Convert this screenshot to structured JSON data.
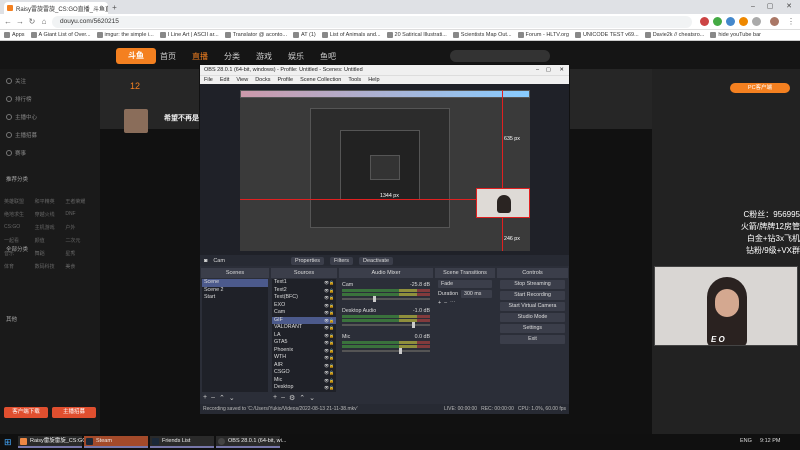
{
  "browser": {
    "tab_title": "Raisy雷旋雷旋_CS:GO直播_斗鱼直播",
    "url": "douyu.com/5620215",
    "bookmarks": [
      "Apps",
      "A Giant List of Over...",
      "imgur: the simple i...",
      "I Line Art | ASCII ar...",
      "Translator @ aconto...",
      "AT (1)",
      "List of Animals and...",
      "20 Satirical Illustrati...",
      "Scientists Map Out...",
      "Forum - HLTV.org",
      "UNICODE TEST v69...",
      "Davie2k // cheatsro...",
      "hide youTube bar"
    ]
  },
  "site": {
    "logo": "斗鱼",
    "nav": [
      "首页",
      "直播",
      "分类",
      "游戏",
      "娱乐",
      "鱼吧"
    ],
    "active_nav": 1,
    "sidebar_top": [
      "关注",
      "排行榜",
      "主播中心",
      "主播招募",
      "赛事"
    ],
    "sidebar_sections": [
      "推荐分类",
      "全部分类",
      "其他"
    ],
    "sidebar_grid": [
      "英雄联盟",
      "和平精英",
      "王者荣耀",
      "绝地求生",
      "穿越火线",
      "DNF",
      "CS:GO",
      "主机游戏",
      "户外",
      "一起看",
      "颜值",
      "二次元",
      "音乐",
      "舞蹈",
      "星秀",
      "体育",
      "数码科技",
      "美食"
    ],
    "sidebar_btn_left": "客户端下载",
    "sidebar_btn_right": "主播招募",
    "follower_count": "12",
    "stream_title_snippet": "希望不再是",
    "button_right": "PC客户端",
    "chat_overlay": [
      "C粉丝：956995",
      "火箭/牌牌12房管",
      "白金+钻3x飞机",
      "钻粉/9级+VX群"
    ],
    "brand_color": "#f48020"
  },
  "obs": {
    "window_title": "OBS 28.0.1 (64-bit, windows) - Profile: Untitled - Scenes: Untitled",
    "menu": [
      "File",
      "Edit",
      "View",
      "Docks",
      "Profile",
      "Scene Collection",
      "Tools",
      "Help"
    ],
    "source_toolbar": {
      "current": "Cam",
      "properties": "Properties",
      "filters": "Filters",
      "deactivate": "Deactivate"
    },
    "scenes": {
      "title": "Scenes",
      "items": [
        "Scene",
        "Scene 2",
        "Start"
      ],
      "selected": 0
    },
    "sources": {
      "title": "Sources",
      "items": [
        "Text1",
        "Text2",
        "Text(BFC)",
        "EXO",
        "Cam",
        "GIF",
        "VALORANT",
        "LA",
        "GTA5",
        "Phoenix",
        "WTH",
        "AIR",
        "CSGO",
        "Mic",
        "Desktop"
      ],
      "selected": 5
    },
    "mixer": {
      "title": "Audio Mixer",
      "channels": [
        {
          "name": "Cam",
          "db": "-25.8 dB",
          "level": 0.35
        },
        {
          "name": "Desktop Audio",
          "db": "-1.0 dB",
          "level": 0.8
        },
        {
          "name": "Mic",
          "db": "0.0 dB",
          "level": 0.65
        }
      ]
    },
    "transitions": {
      "title": "Scene Transitions",
      "type": "Fade",
      "duration_label": "Duration",
      "duration": "300 ms"
    },
    "controls": {
      "title": "Controls",
      "buttons": [
        "Stop Streaming",
        "Start Recording",
        "Start Virtual Camera",
        "Studio Mode",
        "Settings",
        "Exit"
      ]
    },
    "preview_labels": {
      "top": "635 px",
      "mid": "1344 px",
      "bottom": "246 px"
    },
    "status": {
      "recording": "Recording saved to 'C:/Users/Yukio/Videos/2022-08-13 21-11-38.mkv'",
      "live": "LIVE: 00:00:00",
      "rec": "REC: 00:00:00",
      "cpu": "CPU: 1.0%, 60.00 fps"
    }
  },
  "taskbar": {
    "items": [
      "Raisy雷旋雷旋_CS:GO...",
      "Steam",
      "Friends List",
      "OBS 28.0.1 (64-bit, wi..."
    ],
    "lang": "ENG",
    "time": "9:12 PM"
  },
  "webcam": {
    "badge": "E O"
  }
}
